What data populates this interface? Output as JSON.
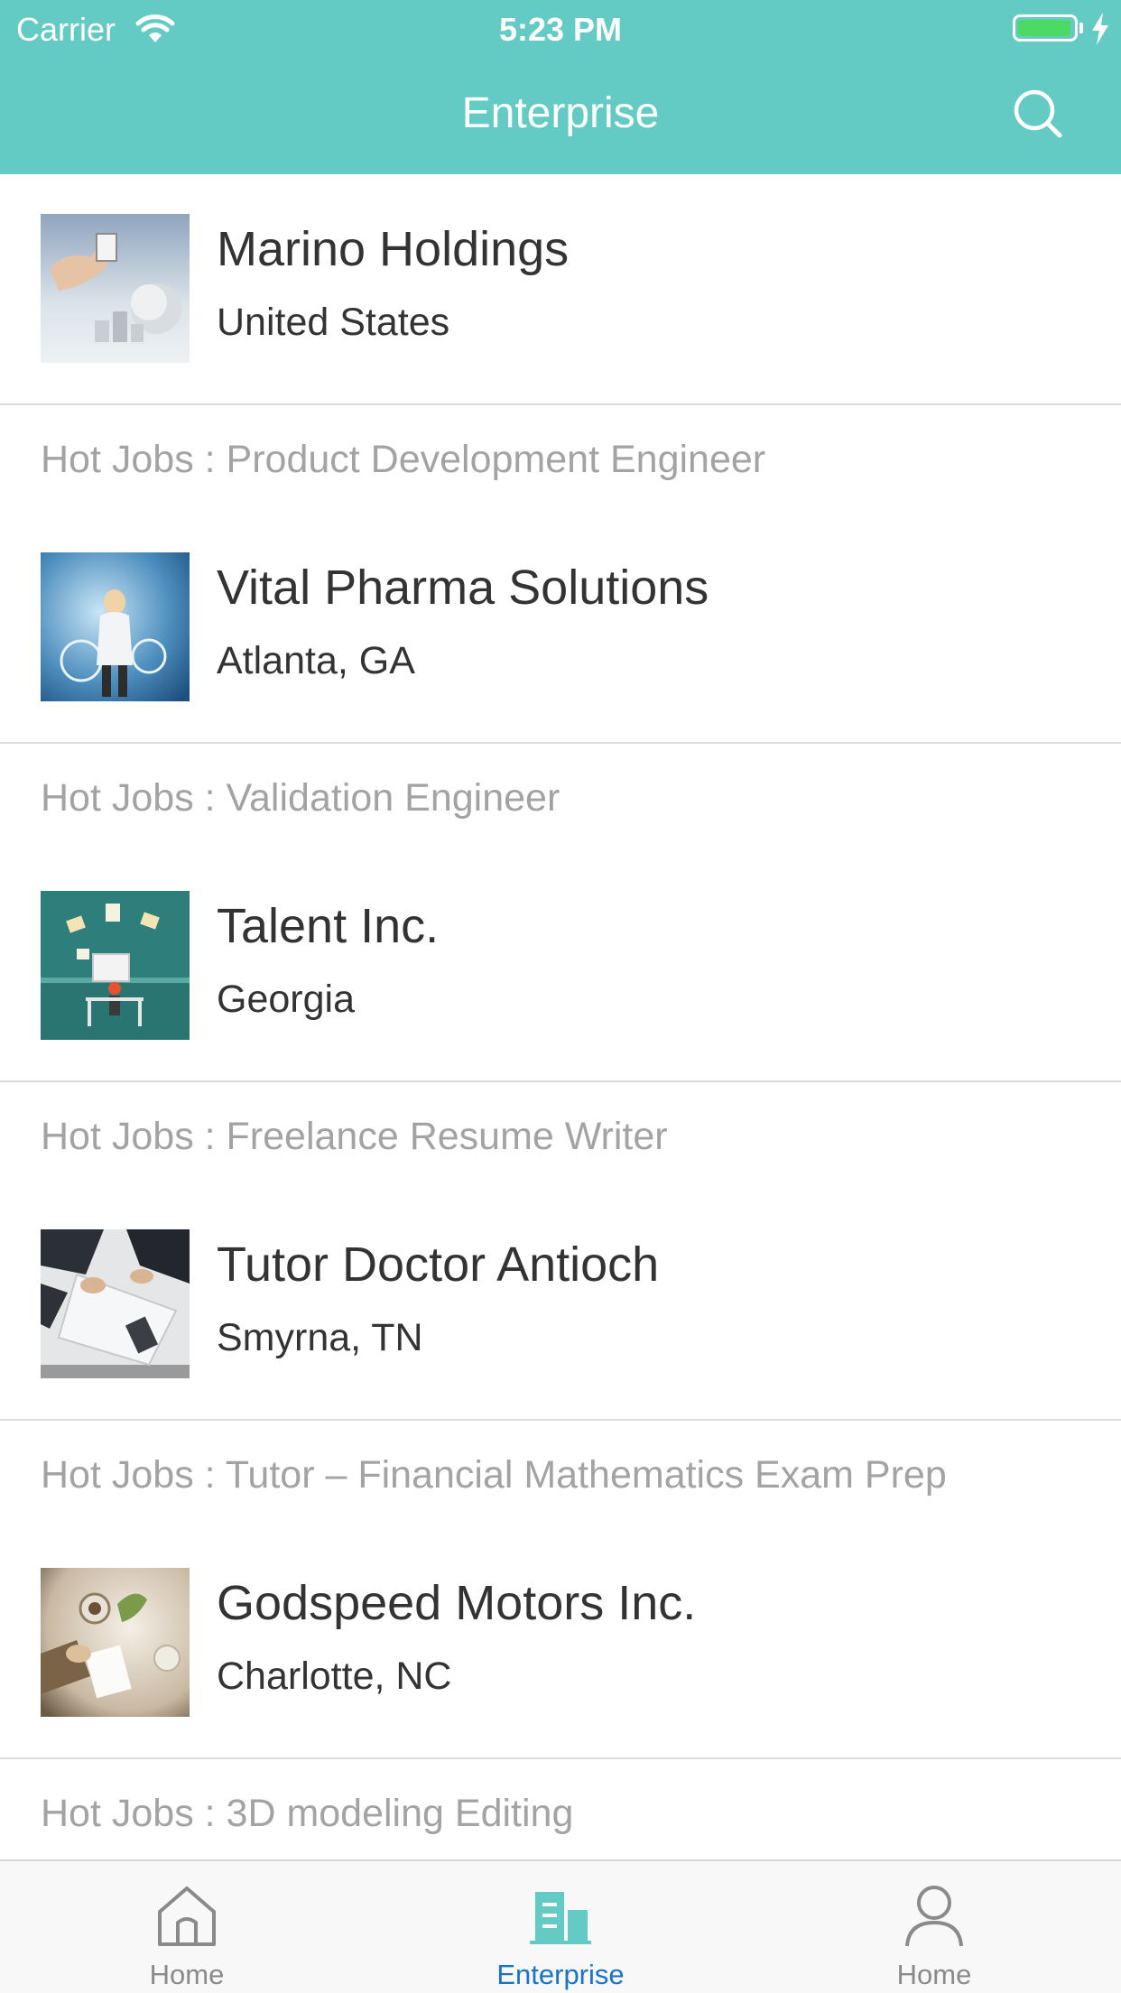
{
  "status_bar": {
    "carrier": "Carrier",
    "time": "5:23 PM",
    "battery_color": "#4cd964"
  },
  "nav": {
    "title": "Enterprise",
    "search_icon": "search-icon",
    "background": "#64cbc4"
  },
  "companies": [
    {
      "name": "Marino Holdings",
      "location": "United States",
      "hot_jobs": "Hot Jobs : Product Development Engineer",
      "image": "globe-hand-image"
    },
    {
      "name": "Vital Pharma Solutions",
      "location": "Atlanta, GA",
      "hot_jobs": "Hot Jobs : Validation Engineer",
      "image": "woman-hologram-image"
    },
    {
      "name": "Talent Inc.",
      "location": "Georgia",
      "hot_jobs": "Hot Jobs : Freelance Resume Writer",
      "image": "office-desk-illustration"
    },
    {
      "name": "Tutor Doctor Antioch",
      "location": "Smyrna, TN",
      "hot_jobs": "Hot Jobs : Tutor – Financial Mathematics Exam Prep",
      "image": "meeting-papers-image"
    },
    {
      "name": "Godspeed Motors Inc.",
      "location": "Charlotte, NC",
      "hot_jobs": "Hot Jobs : 3D modeling Editing",
      "image": "coffee-table-image"
    }
  ],
  "tabbar": {
    "tabs": [
      {
        "label": "Home",
        "icon": "home-icon",
        "active": false
      },
      {
        "label": "Enterprise",
        "icon": "building-icon",
        "active": true
      },
      {
        "label": "Home",
        "icon": "person-icon",
        "active": false
      }
    ],
    "active_color": "#1a73c8",
    "active_icon_color": "#64cbc4",
    "inactive_color": "#8a8a8a"
  }
}
